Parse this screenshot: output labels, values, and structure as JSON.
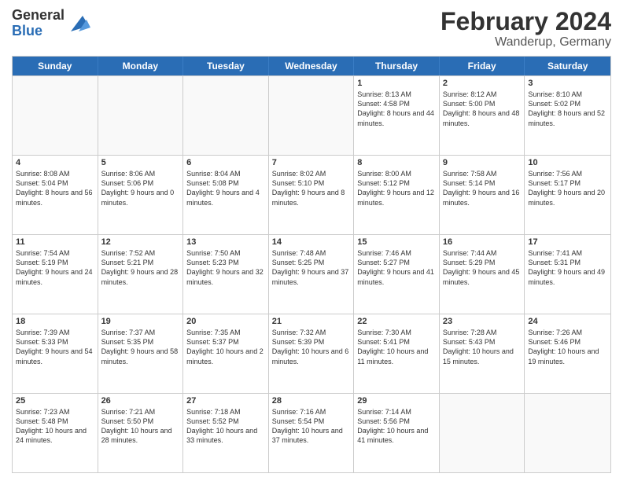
{
  "header": {
    "logo_line1": "General",
    "logo_line2": "Blue",
    "title": "February 2024",
    "subtitle": "Wanderup, Germany"
  },
  "days": [
    "Sunday",
    "Monday",
    "Tuesday",
    "Wednesday",
    "Thursday",
    "Friday",
    "Saturday"
  ],
  "weeks": [
    [
      {
        "day": "",
        "sunrise": "",
        "sunset": "",
        "daylight": ""
      },
      {
        "day": "",
        "sunrise": "",
        "sunset": "",
        "daylight": ""
      },
      {
        "day": "",
        "sunrise": "",
        "sunset": "",
        "daylight": ""
      },
      {
        "day": "",
        "sunrise": "",
        "sunset": "",
        "daylight": ""
      },
      {
        "day": "1",
        "sunrise": "Sunrise: 8:13 AM",
        "sunset": "Sunset: 4:58 PM",
        "daylight": "Daylight: 8 hours and 44 minutes."
      },
      {
        "day": "2",
        "sunrise": "Sunrise: 8:12 AM",
        "sunset": "Sunset: 5:00 PM",
        "daylight": "Daylight: 8 hours and 48 minutes."
      },
      {
        "day": "3",
        "sunrise": "Sunrise: 8:10 AM",
        "sunset": "Sunset: 5:02 PM",
        "daylight": "Daylight: 8 hours and 52 minutes."
      }
    ],
    [
      {
        "day": "4",
        "sunrise": "Sunrise: 8:08 AM",
        "sunset": "Sunset: 5:04 PM",
        "daylight": "Daylight: 8 hours and 56 minutes."
      },
      {
        "day": "5",
        "sunrise": "Sunrise: 8:06 AM",
        "sunset": "Sunset: 5:06 PM",
        "daylight": "Daylight: 9 hours and 0 minutes."
      },
      {
        "day": "6",
        "sunrise": "Sunrise: 8:04 AM",
        "sunset": "Sunset: 5:08 PM",
        "daylight": "Daylight: 9 hours and 4 minutes."
      },
      {
        "day": "7",
        "sunrise": "Sunrise: 8:02 AM",
        "sunset": "Sunset: 5:10 PM",
        "daylight": "Daylight: 9 hours and 8 minutes."
      },
      {
        "day": "8",
        "sunrise": "Sunrise: 8:00 AM",
        "sunset": "Sunset: 5:12 PM",
        "daylight": "Daylight: 9 hours and 12 minutes."
      },
      {
        "day": "9",
        "sunrise": "Sunrise: 7:58 AM",
        "sunset": "Sunset: 5:14 PM",
        "daylight": "Daylight: 9 hours and 16 minutes."
      },
      {
        "day": "10",
        "sunrise": "Sunrise: 7:56 AM",
        "sunset": "Sunset: 5:17 PM",
        "daylight": "Daylight: 9 hours and 20 minutes."
      }
    ],
    [
      {
        "day": "11",
        "sunrise": "Sunrise: 7:54 AM",
        "sunset": "Sunset: 5:19 PM",
        "daylight": "Daylight: 9 hours and 24 minutes."
      },
      {
        "day": "12",
        "sunrise": "Sunrise: 7:52 AM",
        "sunset": "Sunset: 5:21 PM",
        "daylight": "Daylight: 9 hours and 28 minutes."
      },
      {
        "day": "13",
        "sunrise": "Sunrise: 7:50 AM",
        "sunset": "Sunset: 5:23 PM",
        "daylight": "Daylight: 9 hours and 32 minutes."
      },
      {
        "day": "14",
        "sunrise": "Sunrise: 7:48 AM",
        "sunset": "Sunset: 5:25 PM",
        "daylight": "Daylight: 9 hours and 37 minutes."
      },
      {
        "day": "15",
        "sunrise": "Sunrise: 7:46 AM",
        "sunset": "Sunset: 5:27 PM",
        "daylight": "Daylight: 9 hours and 41 minutes."
      },
      {
        "day": "16",
        "sunrise": "Sunrise: 7:44 AM",
        "sunset": "Sunset: 5:29 PM",
        "daylight": "Daylight: 9 hours and 45 minutes."
      },
      {
        "day": "17",
        "sunrise": "Sunrise: 7:41 AM",
        "sunset": "Sunset: 5:31 PM",
        "daylight": "Daylight: 9 hours and 49 minutes."
      }
    ],
    [
      {
        "day": "18",
        "sunrise": "Sunrise: 7:39 AM",
        "sunset": "Sunset: 5:33 PM",
        "daylight": "Daylight: 9 hours and 54 minutes."
      },
      {
        "day": "19",
        "sunrise": "Sunrise: 7:37 AM",
        "sunset": "Sunset: 5:35 PM",
        "daylight": "Daylight: 9 hours and 58 minutes."
      },
      {
        "day": "20",
        "sunrise": "Sunrise: 7:35 AM",
        "sunset": "Sunset: 5:37 PM",
        "daylight": "Daylight: 10 hours and 2 minutes."
      },
      {
        "day": "21",
        "sunrise": "Sunrise: 7:32 AM",
        "sunset": "Sunset: 5:39 PM",
        "daylight": "Daylight: 10 hours and 6 minutes."
      },
      {
        "day": "22",
        "sunrise": "Sunrise: 7:30 AM",
        "sunset": "Sunset: 5:41 PM",
        "daylight": "Daylight: 10 hours and 11 minutes."
      },
      {
        "day": "23",
        "sunrise": "Sunrise: 7:28 AM",
        "sunset": "Sunset: 5:43 PM",
        "daylight": "Daylight: 10 hours and 15 minutes."
      },
      {
        "day": "24",
        "sunrise": "Sunrise: 7:26 AM",
        "sunset": "Sunset: 5:46 PM",
        "daylight": "Daylight: 10 hours and 19 minutes."
      }
    ],
    [
      {
        "day": "25",
        "sunrise": "Sunrise: 7:23 AM",
        "sunset": "Sunset: 5:48 PM",
        "daylight": "Daylight: 10 hours and 24 minutes."
      },
      {
        "day": "26",
        "sunrise": "Sunrise: 7:21 AM",
        "sunset": "Sunset: 5:50 PM",
        "daylight": "Daylight: 10 hours and 28 minutes."
      },
      {
        "day": "27",
        "sunrise": "Sunrise: 7:18 AM",
        "sunset": "Sunset: 5:52 PM",
        "daylight": "Daylight: 10 hours and 33 minutes."
      },
      {
        "day": "28",
        "sunrise": "Sunrise: 7:16 AM",
        "sunset": "Sunset: 5:54 PM",
        "daylight": "Daylight: 10 hours and 37 minutes."
      },
      {
        "day": "29",
        "sunrise": "Sunrise: 7:14 AM",
        "sunset": "Sunset: 5:56 PM",
        "daylight": "Daylight: 10 hours and 41 minutes."
      },
      {
        "day": "",
        "sunrise": "",
        "sunset": "",
        "daylight": ""
      },
      {
        "day": "",
        "sunrise": "",
        "sunset": "",
        "daylight": ""
      }
    ]
  ]
}
